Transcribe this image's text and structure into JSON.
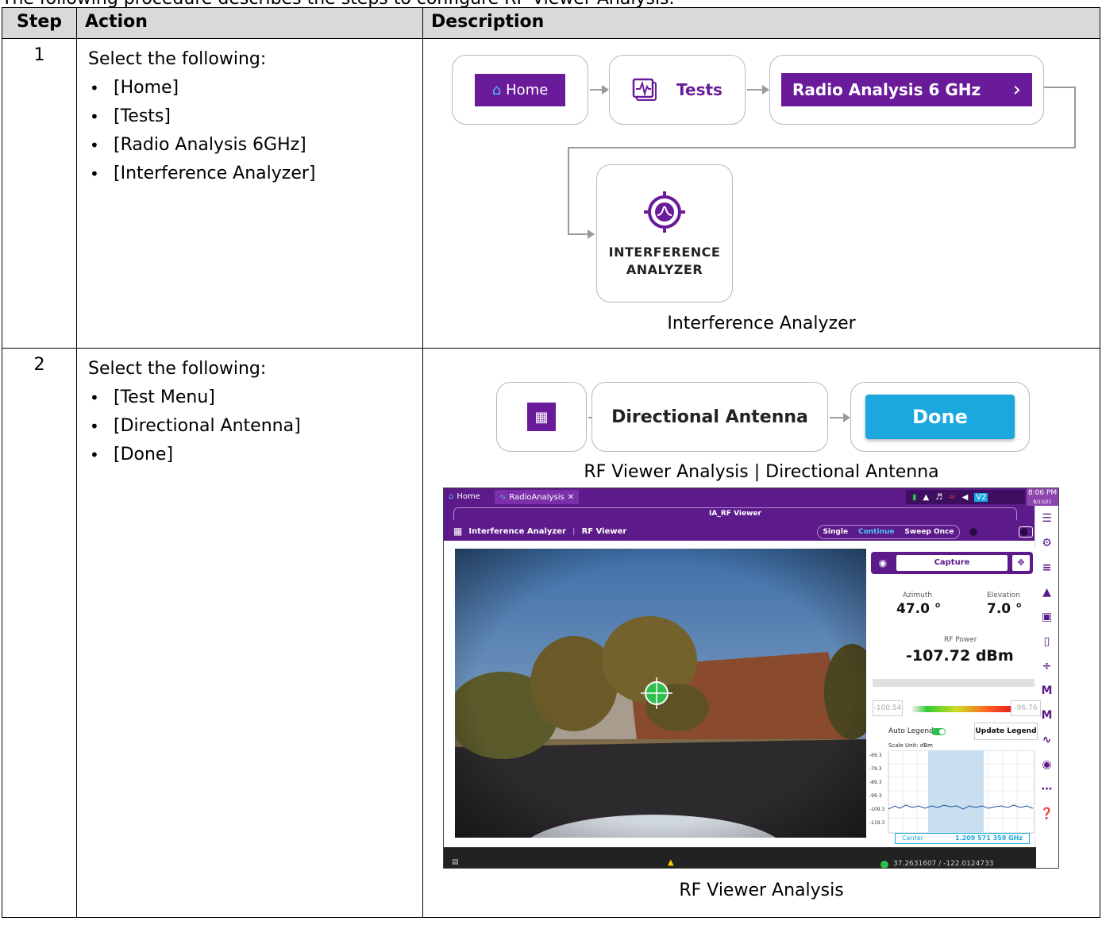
{
  "intro_text": "The following procedure describes the steps to configure RF Viewer Analysis.",
  "table": {
    "headers": [
      "Step",
      "Action",
      "Description"
    ],
    "rows": [
      {
        "step": "1",
        "action_intro": "Select the following:",
        "action_items": [
          "[Home]",
          "[Tests]",
          "[Radio Analysis 6GHz]",
          "[Interference Analyzer]"
        ],
        "flow": {
          "home_label": "Home",
          "tests_label": "Tests",
          "radio_label": "Radio Analysis 6 GHz",
          "ia_line1": "INTERFERENCE",
          "ia_line2": "ANALYZER"
        },
        "caption": "Interference Analyzer"
      },
      {
        "step": "2",
        "action_intro": "Select the following:",
        "action_items": [
          "[Test Menu]",
          "[Directional Antenna]",
          "[Done]"
        ],
        "flow": {
          "directional_label": "Directional Antenna",
          "done_label": "Done"
        },
        "caption_top": "RF Viewer Analysis | Directional Antenna",
        "caption_bottom": "RF Viewer Analysis"
      }
    ]
  },
  "screenshot": {
    "tab_home": "Home",
    "tab_radio": "RadioAnalysis",
    "status_badge": "V2",
    "time": "8:06 PM",
    "date": "8/13/21",
    "window_title": "IA_RF Viewer",
    "breadcrumb_app": "Interference Analyzer",
    "breadcrumb_view": "RF Viewer",
    "mode_single": "Single",
    "mode_continue": "Continue",
    "mode_sweep": "Sweep Once",
    "capture_label": "Capture",
    "azimuth_label": "Azimuth",
    "azimuth_value": "47.0 °",
    "elevation_label": "Elevation",
    "elevation_value": "7.0 °",
    "rf_power_label": "RF Power",
    "rf_power_value": "-107.72 dBm",
    "legend_min": "-100.54",
    "legend_max": "-96.76",
    "auto_legend_label": "Auto Legend",
    "update_legend_label": "Update Legend",
    "scale_unit": "Scale Unit: dBm",
    "y_ticks": [
      "-69.3",
      "-79.3",
      "-89.3",
      "-99.3",
      "-109.3",
      "-119.3"
    ],
    "center_label": "Center",
    "center_value": "1.209 571 359 GHz",
    "gps_coords": "37.2631607 / -122.0124733"
  }
}
